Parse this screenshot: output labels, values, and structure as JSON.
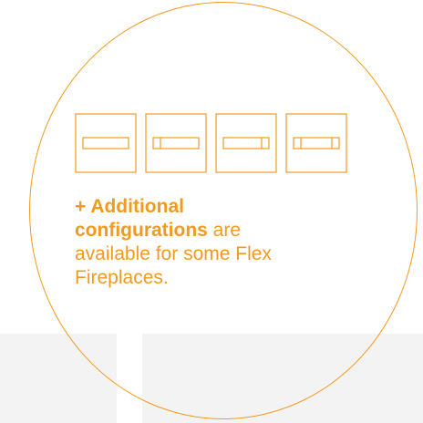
{
  "colors": {
    "accent": "#f39a1e",
    "panel_background": "#f3f3f3",
    "page_background": "#ffffff"
  },
  "icons": [
    "fireplace-configuration-icon",
    "fireplace-configuration-icon",
    "fireplace-configuration-icon",
    "fireplace-configuration-icon"
  ],
  "caption": {
    "bold_text": "+ Additional configurations",
    "regular_text": " are available for some Flex Fireplaces."
  }
}
